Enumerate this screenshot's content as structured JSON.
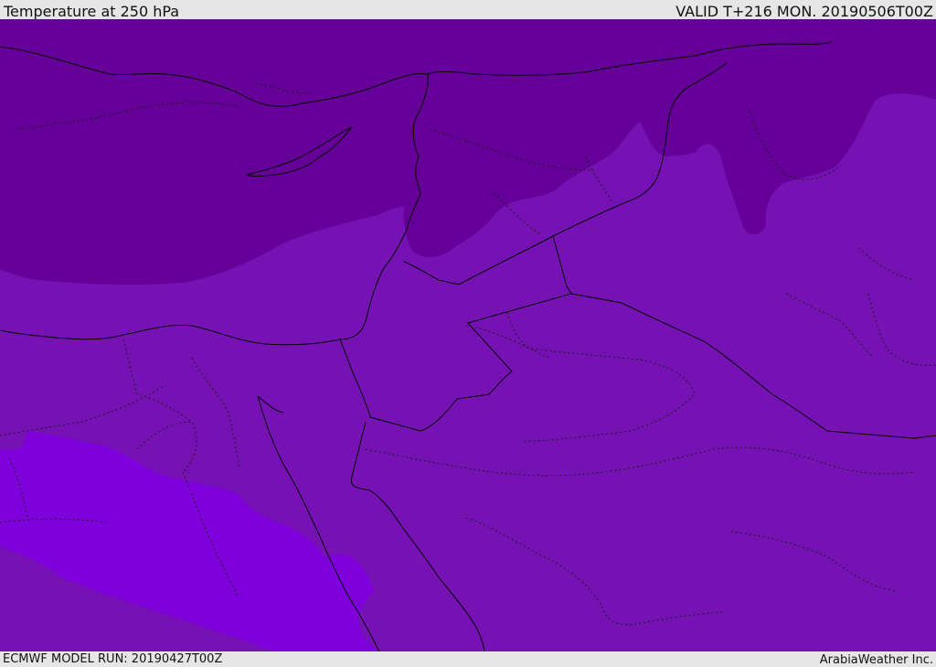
{
  "header": {
    "title": "Temperature at 250 hPa",
    "valid_time": "VALID T+216 MON. 20190506T00Z"
  },
  "footer": {
    "model_run": "ECMWF MODEL RUN: 20190427T00Z",
    "credit": "ArabiaWeather Inc."
  },
  "map": {
    "colors": {
      "cold_band": "#650098",
      "mid_band": "#7612b4",
      "warm_band": "#7e00da",
      "border_line": "#000000"
    }
  }
}
